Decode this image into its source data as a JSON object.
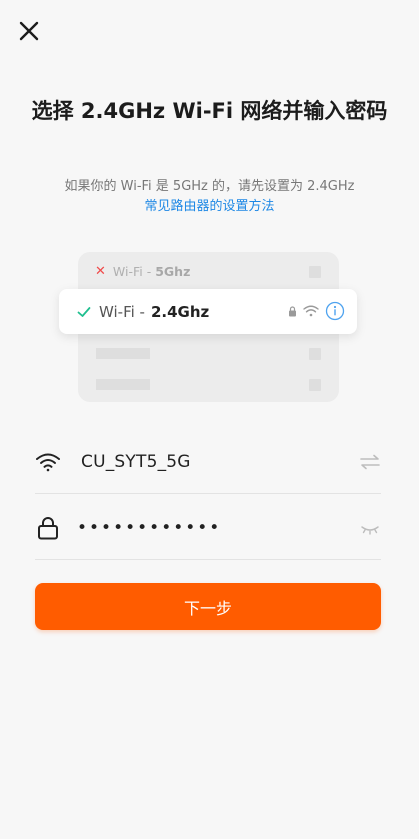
{
  "header": {
    "close_icon": "close-icon"
  },
  "title": "选择 2.4GHz Wi-Fi 网络并输入密码",
  "subtitle": {
    "text": "如果你的 Wi-Fi 是 5GHz 的，请先设置为 2.4GHz",
    "link": "常见路由器的设置方法"
  },
  "illustration": {
    "bad_network": {
      "prefix": "Wi-Fi -",
      "band": "5Ghz"
    },
    "good_network": {
      "prefix": "Wi-Fi -",
      "band": "2.4Ghz"
    }
  },
  "form": {
    "wifi_name": "CU_SYT5_5G",
    "password_masked": "••••••••••••"
  },
  "next_button": "下一步",
  "colors": {
    "accent": "#ff5c00",
    "link": "#1e88e5",
    "check": "#1fbf8f",
    "error": "#f04a4a"
  }
}
